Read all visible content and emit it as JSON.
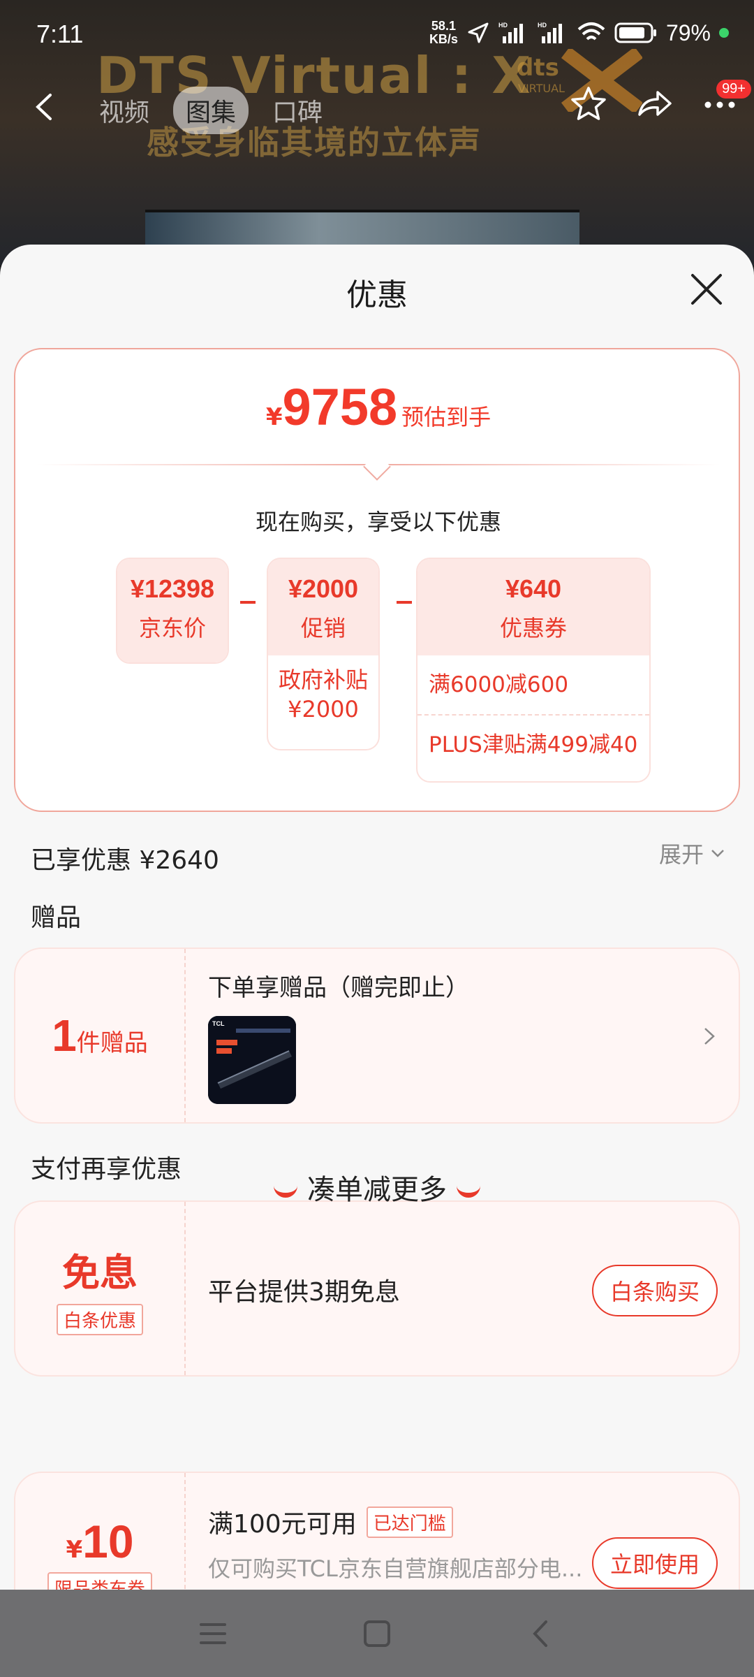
{
  "status_bar": {
    "time": "7:11",
    "net_speed_value": "58.1",
    "net_speed_unit": "KB/s",
    "hd_label": "HD",
    "battery": "79%"
  },
  "background": {
    "banner_title": "DTS Virtual : X",
    "banner_subtitle": "感受身临其境的立体声",
    "dts_logo_text": "dts",
    "dts_logo_sub": "VIRTUAL"
  },
  "nav": {
    "tabs": [
      {
        "label": "视频"
      },
      {
        "label": "图集"
      },
      {
        "label": "口碑"
      }
    ],
    "message_badge": "99+"
  },
  "sheet": {
    "title": "优惠",
    "price": {
      "currency": "¥",
      "amount": "9758",
      "tag": "预估到手"
    },
    "buy_now_text": "现在购买，享受以下优惠",
    "breakdown": {
      "jd_price": {
        "value": "¥12398",
        "label": "京东价"
      },
      "promotion": {
        "value": "¥2000",
        "label": "促销",
        "detail_line1": "政府补贴",
        "detail_line2": "¥2000"
      },
      "coupon": {
        "value": "¥640",
        "label": "优惠券",
        "rows": [
          "满6000减600",
          "PLUS津贴满499减40"
        ]
      }
    },
    "saved_text": "已享优惠 ¥2640",
    "expand_label": "展开",
    "gift_section": {
      "title": "赠品",
      "count": "1",
      "count_unit": "件赠品",
      "headline": "下单享赠品（赠完即止）",
      "thumb_brand": "TCL"
    },
    "payment_section": {
      "title": "支付再享优惠",
      "big_label": "免息",
      "tag": "白条优惠",
      "description": "平台提供3期免息",
      "button": "白条购买"
    },
    "more_section": {
      "title": "凑单减更多",
      "coupon": {
        "currency": "¥",
        "amount": "10",
        "tag": "限品类东券",
        "condition": "满100元可用",
        "reached_badge": "已达门槛",
        "description": "仅可购买TCL京东自营旗舰店部分电...",
        "button": "立即使用"
      }
    }
  },
  "colors": {
    "accent": "#e8392a",
    "card_bg": "#fff6f5",
    "sheet_bg": "#f7f7f7"
  }
}
